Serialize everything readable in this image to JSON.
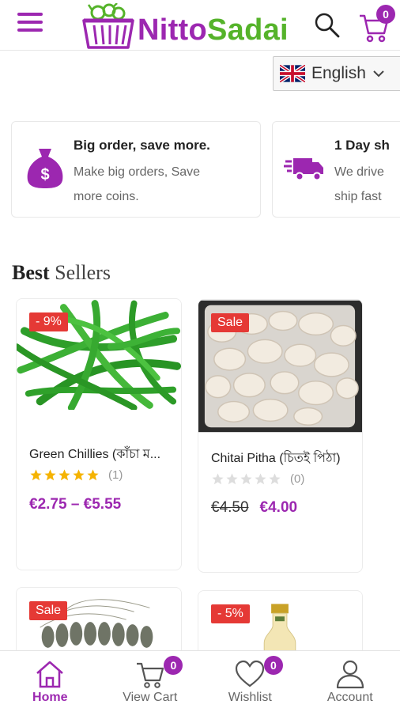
{
  "header": {
    "brand_part1": "Nitto",
    "brand_part2": "Sadai",
    "cart_count": "0"
  },
  "language": {
    "selected": "English"
  },
  "features": [
    {
      "title": "Big order, save more.",
      "description": "Make big orders, Save\nmore coins."
    },
    {
      "title": "1 Day sh",
      "description": "We drive\nship fast"
    }
  ],
  "best_sellers": {
    "title_bold": "Best",
    "title_light": "Sellers",
    "products": [
      {
        "tag": "- 9%",
        "name": "Green Chillies (কাঁচা ম...",
        "rating_count": "(1)",
        "rating": 5,
        "price": "€2.75 – €5.55"
      },
      {
        "tag": "Sale",
        "name": "Chitai Pitha (চিতই পিঠা)",
        "rating_count": "(0)",
        "rating": 0,
        "old_price": "€4.50",
        "price": "€4.00"
      },
      {
        "tag": "Sale"
      },
      {
        "tag": "- 5%"
      }
    ]
  },
  "bottom_nav": {
    "home": "Home",
    "view_cart": "View Cart",
    "view_cart_count": "0",
    "wishlist": "Wishlist",
    "wishlist_count": "0",
    "account": "Account"
  },
  "colors": {
    "brand_purple": "#9c27b0",
    "brand_green": "#55b32a",
    "sale_red": "#e53935",
    "star_gold": "#f5b301"
  }
}
